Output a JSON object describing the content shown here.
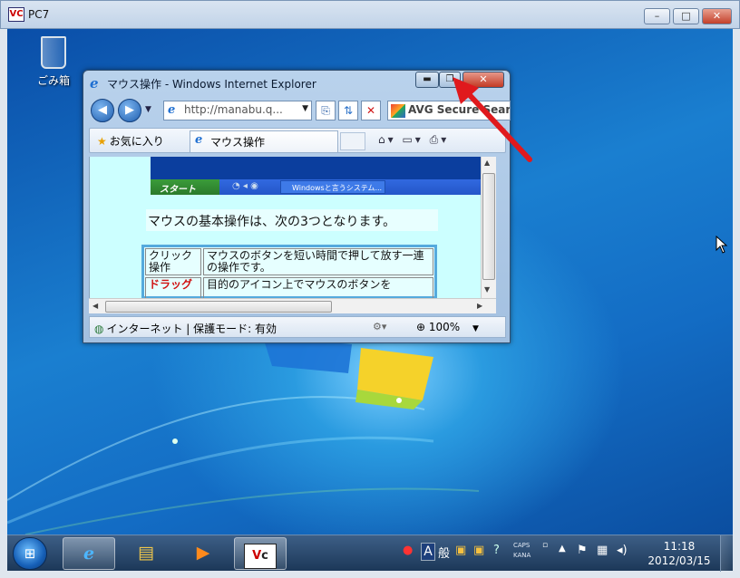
{
  "outer_window": {
    "title": "PC7",
    "icon": "VC",
    "minimize": "–",
    "maximize": "□",
    "close": "✕"
  },
  "desktop": {
    "recycle_bin_label": "ごみ箱"
  },
  "ie_window": {
    "title": "マウス操作 - Windows Internet Explorer",
    "address": "http://manabu.q...",
    "avg_label": "AVG Secure Search",
    "favorites_label": "お気に入り",
    "tab_label": "マウス操作",
    "status_zone": "インターネット | 保護モード: 有効",
    "zoom": "100%"
  },
  "page_content": {
    "embedded_start": "スタート",
    "embedded_task_button": "Windowsと言うシステム...",
    "sentence": "マウスの基本操作は、次の3つとなります。",
    "table": [
      {
        "term": "クリック操作",
        "description": "マウスのボタンを短い時間で押して放す一連の操作です。"
      },
      {
        "term": "ドラッグ",
        "description": "目的のアイコン上でマウスのボタンを"
      }
    ]
  },
  "taskbar": {
    "apps": [
      "internet-explorer",
      "explorer",
      "media-player",
      "vnc-viewer"
    ],
    "ime_mode": "A",
    "ime_han": "般",
    "caps": "CAPS",
    "kana": "KANA",
    "time": "11:18",
    "date": "2012/03/15"
  },
  "colors": {
    "annotation_arrow": "#e0191d",
    "page_background": "#ccffff",
    "table_border": "#55aadd"
  }
}
